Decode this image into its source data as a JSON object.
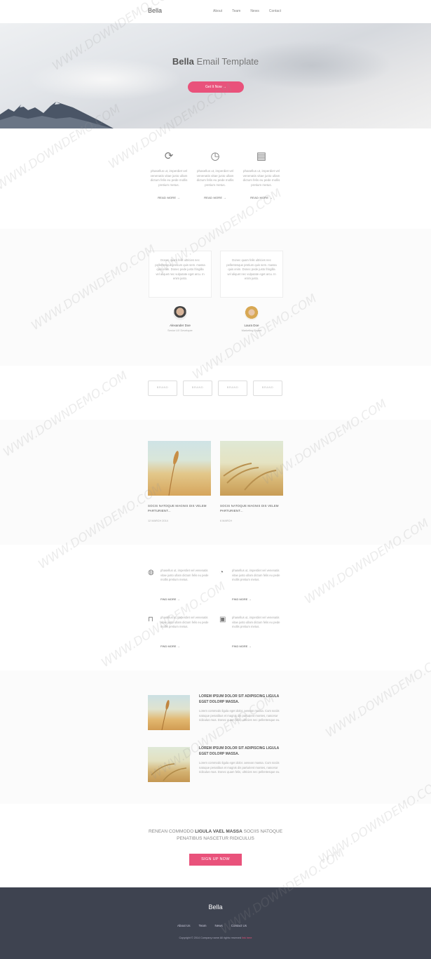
{
  "header": {
    "brand": "Bella",
    "nav": [
      "About",
      "Team",
      "News",
      "Contact"
    ]
  },
  "hero": {
    "title_bold": "Bella",
    "title_rest": " Email Template",
    "button": "Get It Now →"
  },
  "features": [
    {
      "icon": "refresh-icon",
      "text": "phasellus ut, imperdiet vel venenatis vitae justo ullam dictum felis eu pede mollis pretium metus.",
      "link": "READ MORE →"
    },
    {
      "icon": "timer-icon",
      "text": "phasellus ut, imperdiet vel venenatis vitae justo ullam dictum felis eu pede mollis pretium metus.",
      "link": "READ MORE →"
    },
    {
      "icon": "clipboard-icon",
      "text": "phasellus ut, imperdiet vel venenatis vitae justo ullam dictum felis eu pede mollis pretium metus.",
      "link": "READ MORE →"
    }
  ],
  "testimonials": [
    {
      "quote": "Donec quam felis ultricies nec pellentesque pretium quis sem. massa quis enim. Donec pede justo fringilla vel aliquet nec vulputate eget arcu. In enim justo.",
      "name": "Alexander Doe",
      "role": "Senior UX Developer"
    },
    {
      "quote": "Donec quam felis ultricies nec pellentesque pretium quis sem. massa quis enim. Donec pede justo fringilla vel aliquet nec vulputate eget arcu. In enim justo.",
      "name": "Laura Doe",
      "role": "Marketing Expert"
    }
  ],
  "logos": [
    "BRAND",
    "BRAND",
    "BRAND",
    "BRAND"
  ],
  "articles": [
    {
      "title": "SOCIS NATOQUE MAGNIS DIS VELEM PARTURIENT...",
      "date": "12 MARCH 2014"
    },
    {
      "title": "SOCIS NATOQUE MAGNIS DIS VELEM PARTURIENT...",
      "date": "6 MARCH"
    }
  ],
  "features4": [
    {
      "icon": "globe-icon",
      "text": "phasellus ut, imperdiet vel venenatis vitae justo ullam dictum felis eu pede mollis pretium metus.",
      "link": "FIND MORE →"
    },
    {
      "icon": "clock-icon",
      "text": "phasellus ut, imperdiet vel venenatis vitae justo ullam dictum felis eu pede mollis pretium metus.",
      "link": "FIND MORE →"
    },
    {
      "icon": "unlock-icon",
      "text": "phasellus ut, imperdiet vel venenatis vitae justo ullam dictum felis eu pede mollis pretium metus.",
      "link": "FIND MORE →"
    },
    {
      "icon": "save-icon",
      "text": "phasellus ut, imperdiet vel venenatis vitae justo ullam dictum felis eu pede mollis pretium metus.",
      "link": "FIND MORE →"
    }
  ],
  "blog": [
    {
      "title": "LOREM IPSUM DOLOR SIT ADIPISCING LIGULA EGET DOLORP MASSA.",
      "text": "Lorem commodo ligula eget dolor. aenean massa. Cum sociis natoque penatibus et magnis dis parturient montes, nascetur ridiculus mus. Donec quam felis, ultricies nec pellentesque eu."
    },
    {
      "title": "LOREM IPSUM DOLOR SIT ADIPISCING LIGULA EGET DOLORP MASSA.",
      "text": "Lorem commodo ligula eget dolor. aenean massa. Cum sociis natoque penatibus et magnis dis parturient montes, nascetur ridiculus mus. Donec quam felis, ultricies nec pellentesque eu."
    }
  ],
  "signup": {
    "text_a": "RENEAN COMMODO ",
    "text_b": "LIGULA VAEL MASSA",
    "text_c": " SOCIIS NATOQUE PENATIBUS NASCETUR RIDICULUS",
    "button": "SIGN UP NOW"
  },
  "footer": {
    "brand": "Bella",
    "nav": [
      "About Us",
      "Team",
      "News",
      "Contact Us"
    ],
    "copyright": "Copyright © 2014 Company name All rights reserved ",
    "copyright_link": "link here"
  },
  "watermark": "WWW.DOWNDEMO.COM",
  "colors": {
    "accent": "#e9527b",
    "footer": "#3e4350"
  }
}
